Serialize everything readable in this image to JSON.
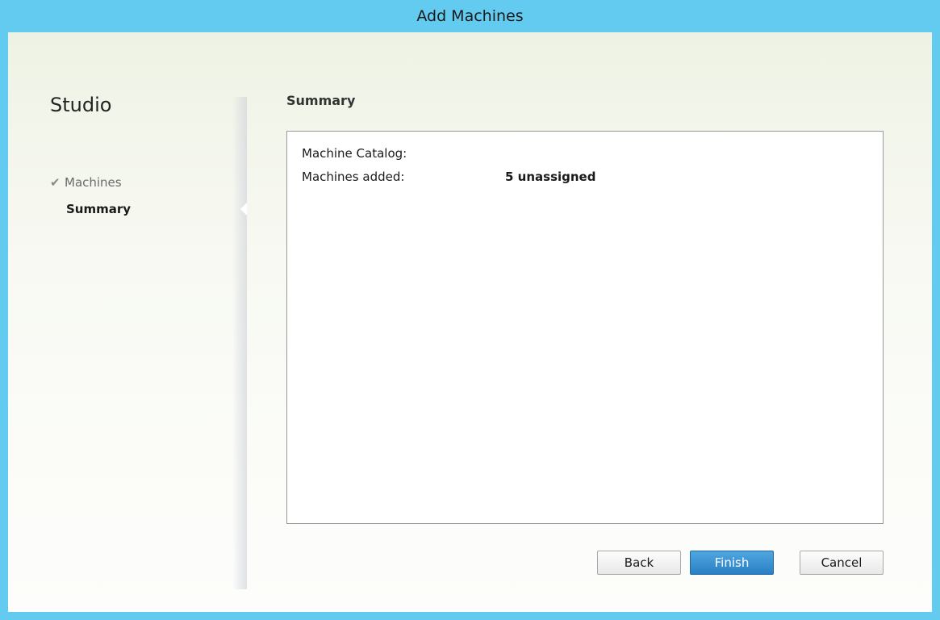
{
  "window": {
    "title": "Add Machines",
    "accent_color": "#63cbf0"
  },
  "sidebar": {
    "title": "Studio",
    "steps": [
      {
        "label": "Machines",
        "completed": true,
        "icon": "check-icon"
      },
      {
        "label": "Summary",
        "completed": false,
        "current": true
      }
    ]
  },
  "main": {
    "section_title": "Summary",
    "rows": [
      {
        "label": "Machine Catalog:",
        "value": ""
      },
      {
        "label": "Machines added:",
        "value": "5 unassigned"
      }
    ]
  },
  "buttons": {
    "back": "Back",
    "finish": "Finish",
    "cancel": "Cancel",
    "primary_color": "#2a7fc4"
  }
}
